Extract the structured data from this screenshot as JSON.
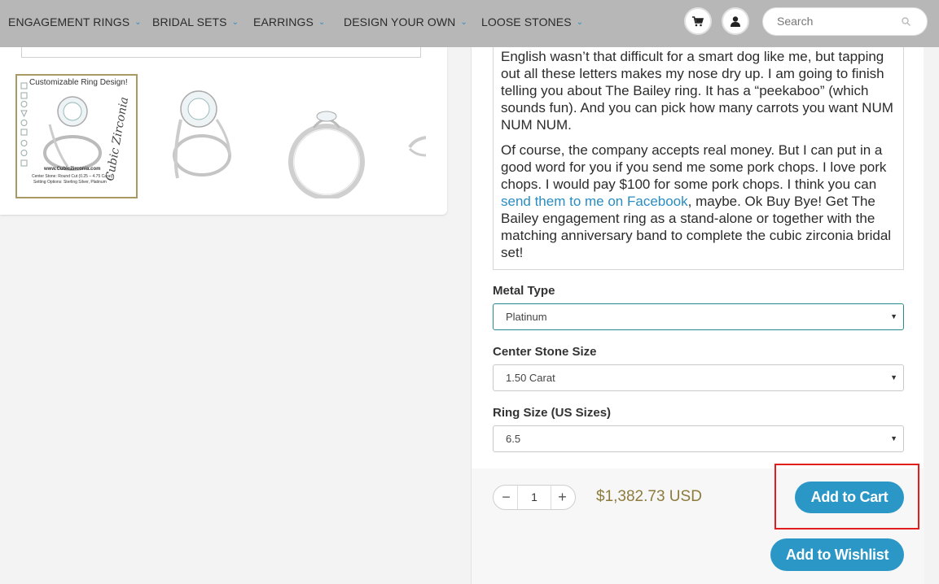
{
  "nav": {
    "items": [
      {
        "label": "ENGAGEMENT RINGS"
      },
      {
        "label": "BRIDAL SETS"
      },
      {
        "label": "EARRINGS"
      },
      {
        "label": "DESIGN YOUR OWN"
      },
      {
        "label": "LOOSE STONES"
      }
    ],
    "search_placeholder": "Search"
  },
  "gallery": {
    "thumb1": {
      "title": "Customizable Ring Design!",
      "url": "www.CubicZirconia.com",
      "center_stone": "Center Stone: Round Cut (0.25 – 4.75 Carat)",
      "setting_options": "Setting Options: Sterling Silver, Platinum",
      "logo": "Cubic Zirconia"
    }
  },
  "description": {
    "p1": "English wasn’t that difficult for a smart dog like me, but tapping out all these letters makes my nose dry up. I am going to finish telling you about The Bailey ring. It has a “peekaboo” (which sounds fun). And you can pick how many carrots you want NUM NUM NUM.",
    "p2_before": "Of course, the company accepts real money. But I can put in a good word for you if you send me some pork chops. I love pork chops. I would pay $100 for some pork chops. I think you can ",
    "p2_link": "send them to me on Facebook",
    "p2_after": ", maybe. Ok Buy Bye! Get The Bailey engagement ring as a stand-alone or together with the matching anniversary band to complete the cubic zirconia bridal set!"
  },
  "options": {
    "metal_type": {
      "label": "Metal Type",
      "value": "Platinum"
    },
    "center_stone_size": {
      "label": "Center Stone Size",
      "value": "1.50 Carat"
    },
    "ring_size": {
      "label": "Ring Size (US Sizes)",
      "value": "6.5"
    }
  },
  "purchase": {
    "quantity": "1",
    "minus": "−",
    "plus": "+",
    "price": "$1,382.73 USD",
    "add_to_cart": "Add to Cart",
    "add_to_wishlist": "Add to Wishlist"
  },
  "colors": {
    "accent": "#2a97c7",
    "price": "#8d7b3d",
    "highlight": "#e11d1d",
    "nav_bg": "#b7b7b7"
  },
  "icons": {
    "cart": "cart-icon",
    "account": "user-icon",
    "search": "search-icon",
    "dropdown": "chevron-down-icon"
  }
}
